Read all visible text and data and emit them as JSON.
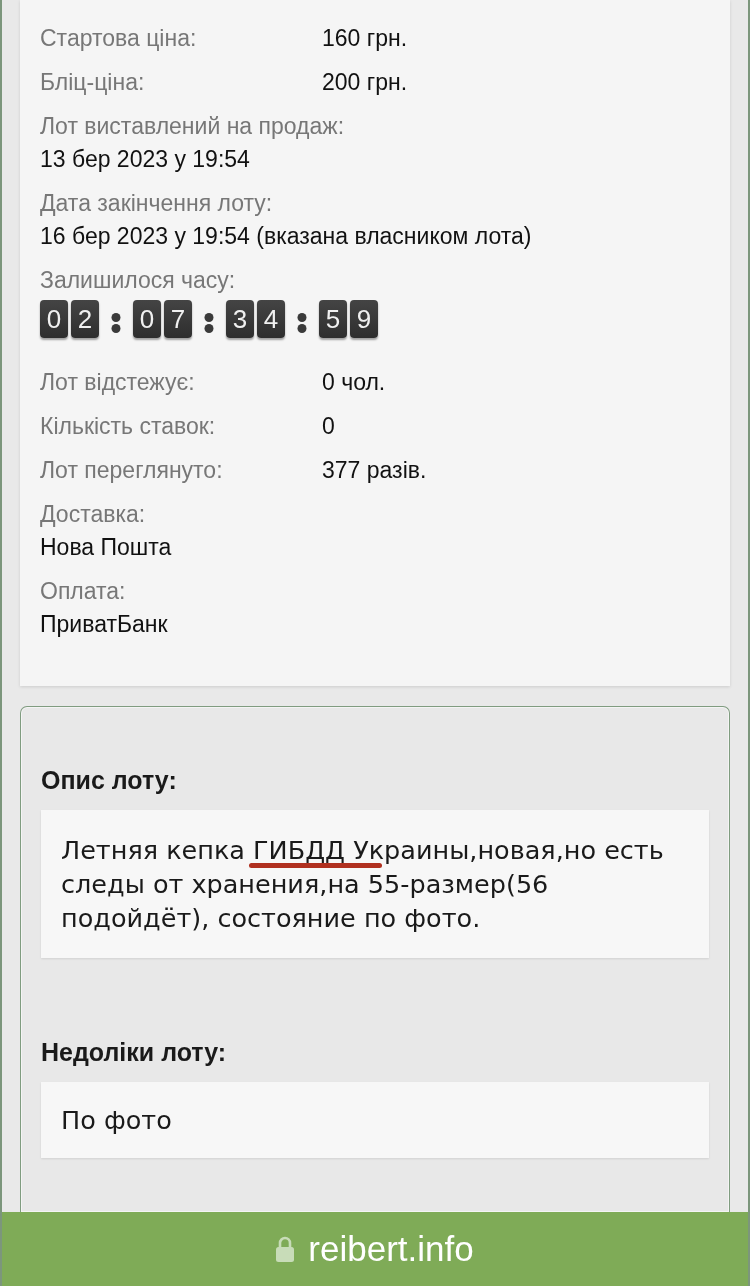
{
  "lot_details": [
    {
      "kind": "inline",
      "label": "Стартова ціна:",
      "value": "160 грн."
    },
    {
      "kind": "inline",
      "label": "Бліц-ціна:",
      "value": "200 грн."
    },
    {
      "kind": "stacked",
      "label": "Лот виставлений на продаж:",
      "value": "13 бер 2023 у 19:54"
    },
    {
      "kind": "stacked",
      "label": "Дата закінчення лоту:",
      "value": "16 бер 2023 у 19:54 (вказана власником лота)"
    },
    {
      "kind": "timer",
      "label": "Залишилося часу:",
      "groups": [
        [
          "0",
          "2"
        ],
        [
          "0",
          "7"
        ],
        [
          "3",
          "4"
        ],
        [
          "5",
          "9"
        ]
      ]
    },
    {
      "kind": "inline",
      "label": "Лот відстежує:",
      "value": "0 чол."
    },
    {
      "kind": "inline",
      "label": "Кількість ставок:",
      "value": "0"
    },
    {
      "kind": "inline",
      "label": "Лот переглянуто:",
      "value": "377 разів."
    },
    {
      "kind": "stacked",
      "label": "Доставка:",
      "value": "Нова Пошта"
    },
    {
      "kind": "stacked",
      "label": "Оплата:",
      "value": "ПриватБанк"
    }
  ],
  "sections": [
    {
      "heading": "Опис лоту:",
      "text": "Летняя кепка ГИБДД Украины,новая,но есть следы от хранения,на 55-размер(56 подойдёт), состояние по фото.",
      "underline_annotation": true
    },
    {
      "heading": "Недоліки лоту:",
      "text": "По фото",
      "underline_annotation": false
    }
  ],
  "address_bar": {
    "domain": "reibert.info"
  }
}
